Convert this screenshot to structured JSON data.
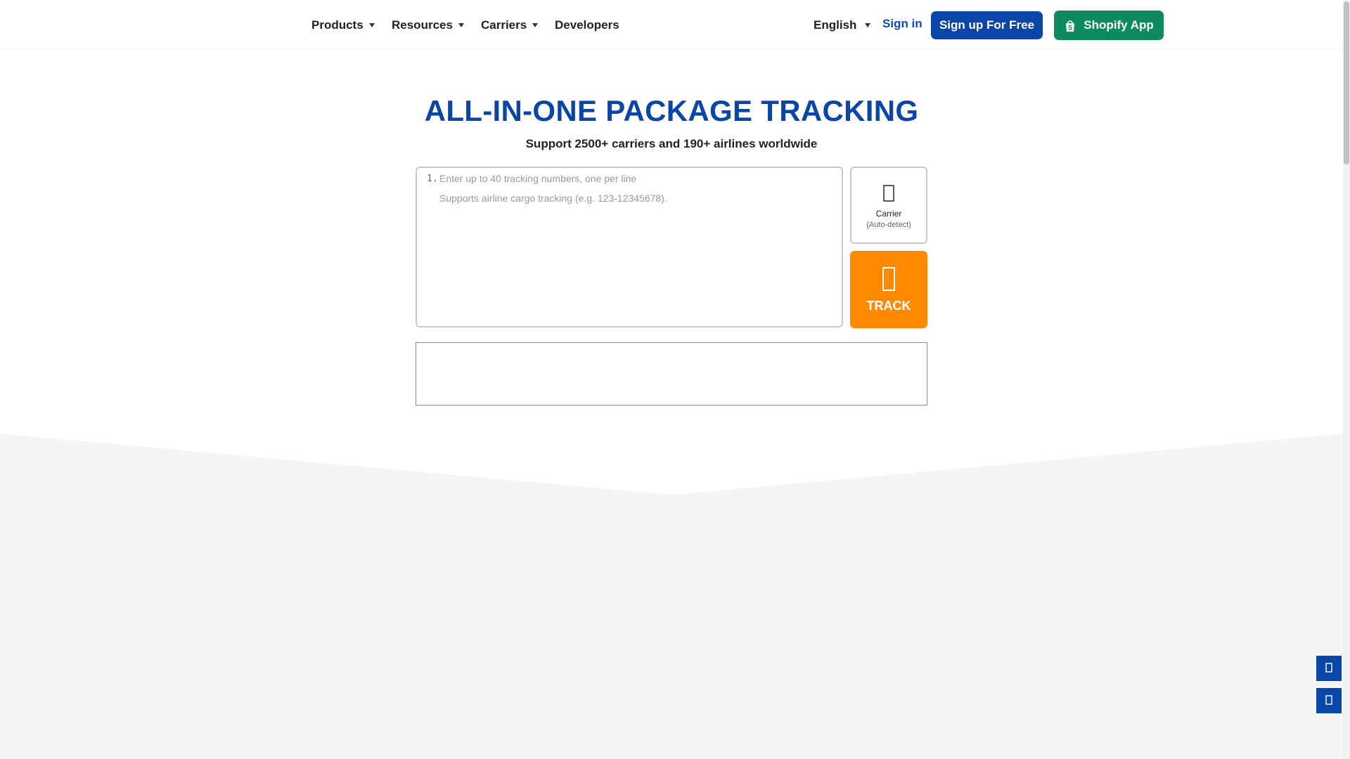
{
  "header": {
    "nav": [
      {
        "label": "Products"
      },
      {
        "label": "Resources"
      },
      {
        "label": "Carriers"
      },
      {
        "label": "Developers"
      }
    ],
    "language": "English",
    "sign_in": "Sign in",
    "signup_button": "Sign up For Free",
    "shopify_button": "Shopify App"
  },
  "hero": {
    "title": "ALL-IN-ONE PACKAGE TRACKING",
    "subtitle": "Support 2500+ carriers and 190+ airlines worldwide"
  },
  "tracking_input": {
    "line_number": "1.",
    "placeholder_line1": "Enter up to 40 tracking numbers, one per line",
    "placeholder_line2": "Supports airline cargo tracking (e.g. 123-12345678)."
  },
  "carrier_selector": {
    "icon": "carrier-icon",
    "label": "Carrier",
    "sublabel": "(Auto-detect)"
  },
  "track_button": {
    "label": "TRACK",
    "icon": "search-bolt-icon"
  },
  "colors": {
    "brand_blue": "#0a46a8",
    "track_orange": "#ff8a00",
    "shopify_green": "#0d8a5e",
    "band_gray": "#f5f5f5"
  }
}
